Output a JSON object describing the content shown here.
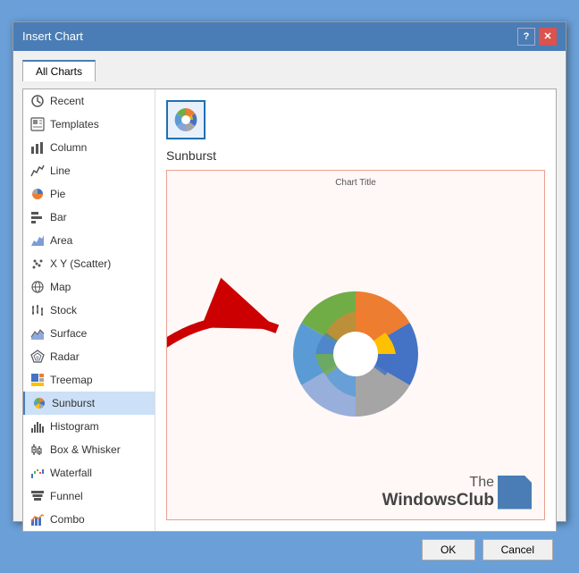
{
  "dialog": {
    "title": "Insert Chart",
    "help_btn": "?",
    "close_btn": "✕"
  },
  "tabs": [
    {
      "id": "all-charts",
      "label": "All Charts",
      "active": true
    }
  ],
  "sidebar": {
    "items": [
      {
        "id": "recent",
        "label": "Recent",
        "icon": "recent"
      },
      {
        "id": "templates",
        "label": "Templates",
        "icon": "templates"
      },
      {
        "id": "column",
        "label": "Column",
        "icon": "column"
      },
      {
        "id": "line",
        "label": "Line",
        "icon": "line"
      },
      {
        "id": "pie",
        "label": "Pie",
        "icon": "pie"
      },
      {
        "id": "bar",
        "label": "Bar",
        "icon": "bar"
      },
      {
        "id": "area",
        "label": "Area",
        "icon": "area"
      },
      {
        "id": "scatter",
        "label": "X Y (Scatter)",
        "icon": "scatter"
      },
      {
        "id": "map",
        "label": "Map",
        "icon": "map"
      },
      {
        "id": "stock",
        "label": "Stock",
        "icon": "stock"
      },
      {
        "id": "surface",
        "label": "Surface",
        "icon": "surface"
      },
      {
        "id": "radar",
        "label": "Radar",
        "icon": "radar"
      },
      {
        "id": "treemap",
        "label": "Treemap",
        "icon": "treemap"
      },
      {
        "id": "sunburst",
        "label": "Sunburst",
        "icon": "sunburst",
        "selected": true
      },
      {
        "id": "histogram",
        "label": "Histogram",
        "icon": "histogram"
      },
      {
        "id": "box-whisker",
        "label": "Box & Whisker",
        "icon": "box-whisker"
      },
      {
        "id": "waterfall",
        "label": "Waterfall",
        "icon": "waterfall"
      },
      {
        "id": "funnel",
        "label": "Funnel",
        "icon": "funnel"
      },
      {
        "id": "combo",
        "label": "Combo",
        "icon": "combo"
      }
    ]
  },
  "content": {
    "selected_chart_name": "Sunburst",
    "chart_title": "Chart Title",
    "chart_icons": [
      {
        "id": "sunburst-1",
        "selected": true
      }
    ]
  },
  "footer": {
    "ok_label": "OK",
    "cancel_label": "Cancel"
  },
  "watermark": {
    "line1": "The",
    "line2": "WindowsClub"
  }
}
